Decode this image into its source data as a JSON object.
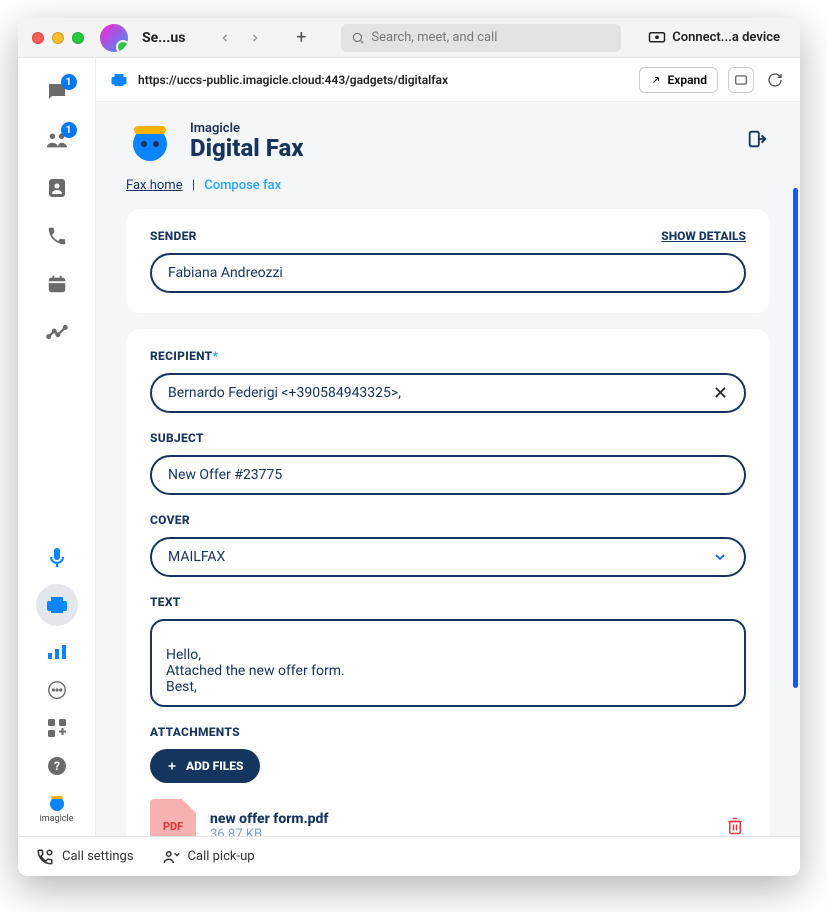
{
  "titlebar": {
    "status": "Se...us",
    "search_placeholder": "Search, meet, and call",
    "connect_device": "Connect...a device"
  },
  "leftbar": {
    "chat_badge": "1",
    "teams_badge": "1",
    "imagicle_label": "imagicle"
  },
  "urlbar": {
    "url": "https://uccs-public.imagicle.cloud:443/gadgets/digitalfax",
    "expand_label": "Expand"
  },
  "brand": {
    "small": "Imagicle",
    "big": "Digital Fax"
  },
  "breadcrumbs": {
    "home": "Fax home",
    "current": "Compose fax"
  },
  "form": {
    "sender_label": "SENDER",
    "show_details": "SHOW DETAILS",
    "sender_value": "Fabiana Andreozzi",
    "recipient_label": "RECIPIENT",
    "recipient_value": "Bernardo Federigi <+390584943325>,",
    "subject_label": "SUBJECT",
    "subject_value": "New Offer #23775",
    "cover_label": "COVER",
    "cover_value": "MAILFAX",
    "text_label": "TEXT",
    "text_value": "Hello,\nAttached the new offer form.\nBest,",
    "attachments_label": "ATTACHMENTS",
    "add_files_label": "ADD FILES",
    "attachment": {
      "name": "new offer form.pdf",
      "size": "36.87 KB",
      "badge": "PDF"
    }
  },
  "bottombar": {
    "call_settings": "Call settings",
    "call_pickup": "Call pick-up"
  }
}
